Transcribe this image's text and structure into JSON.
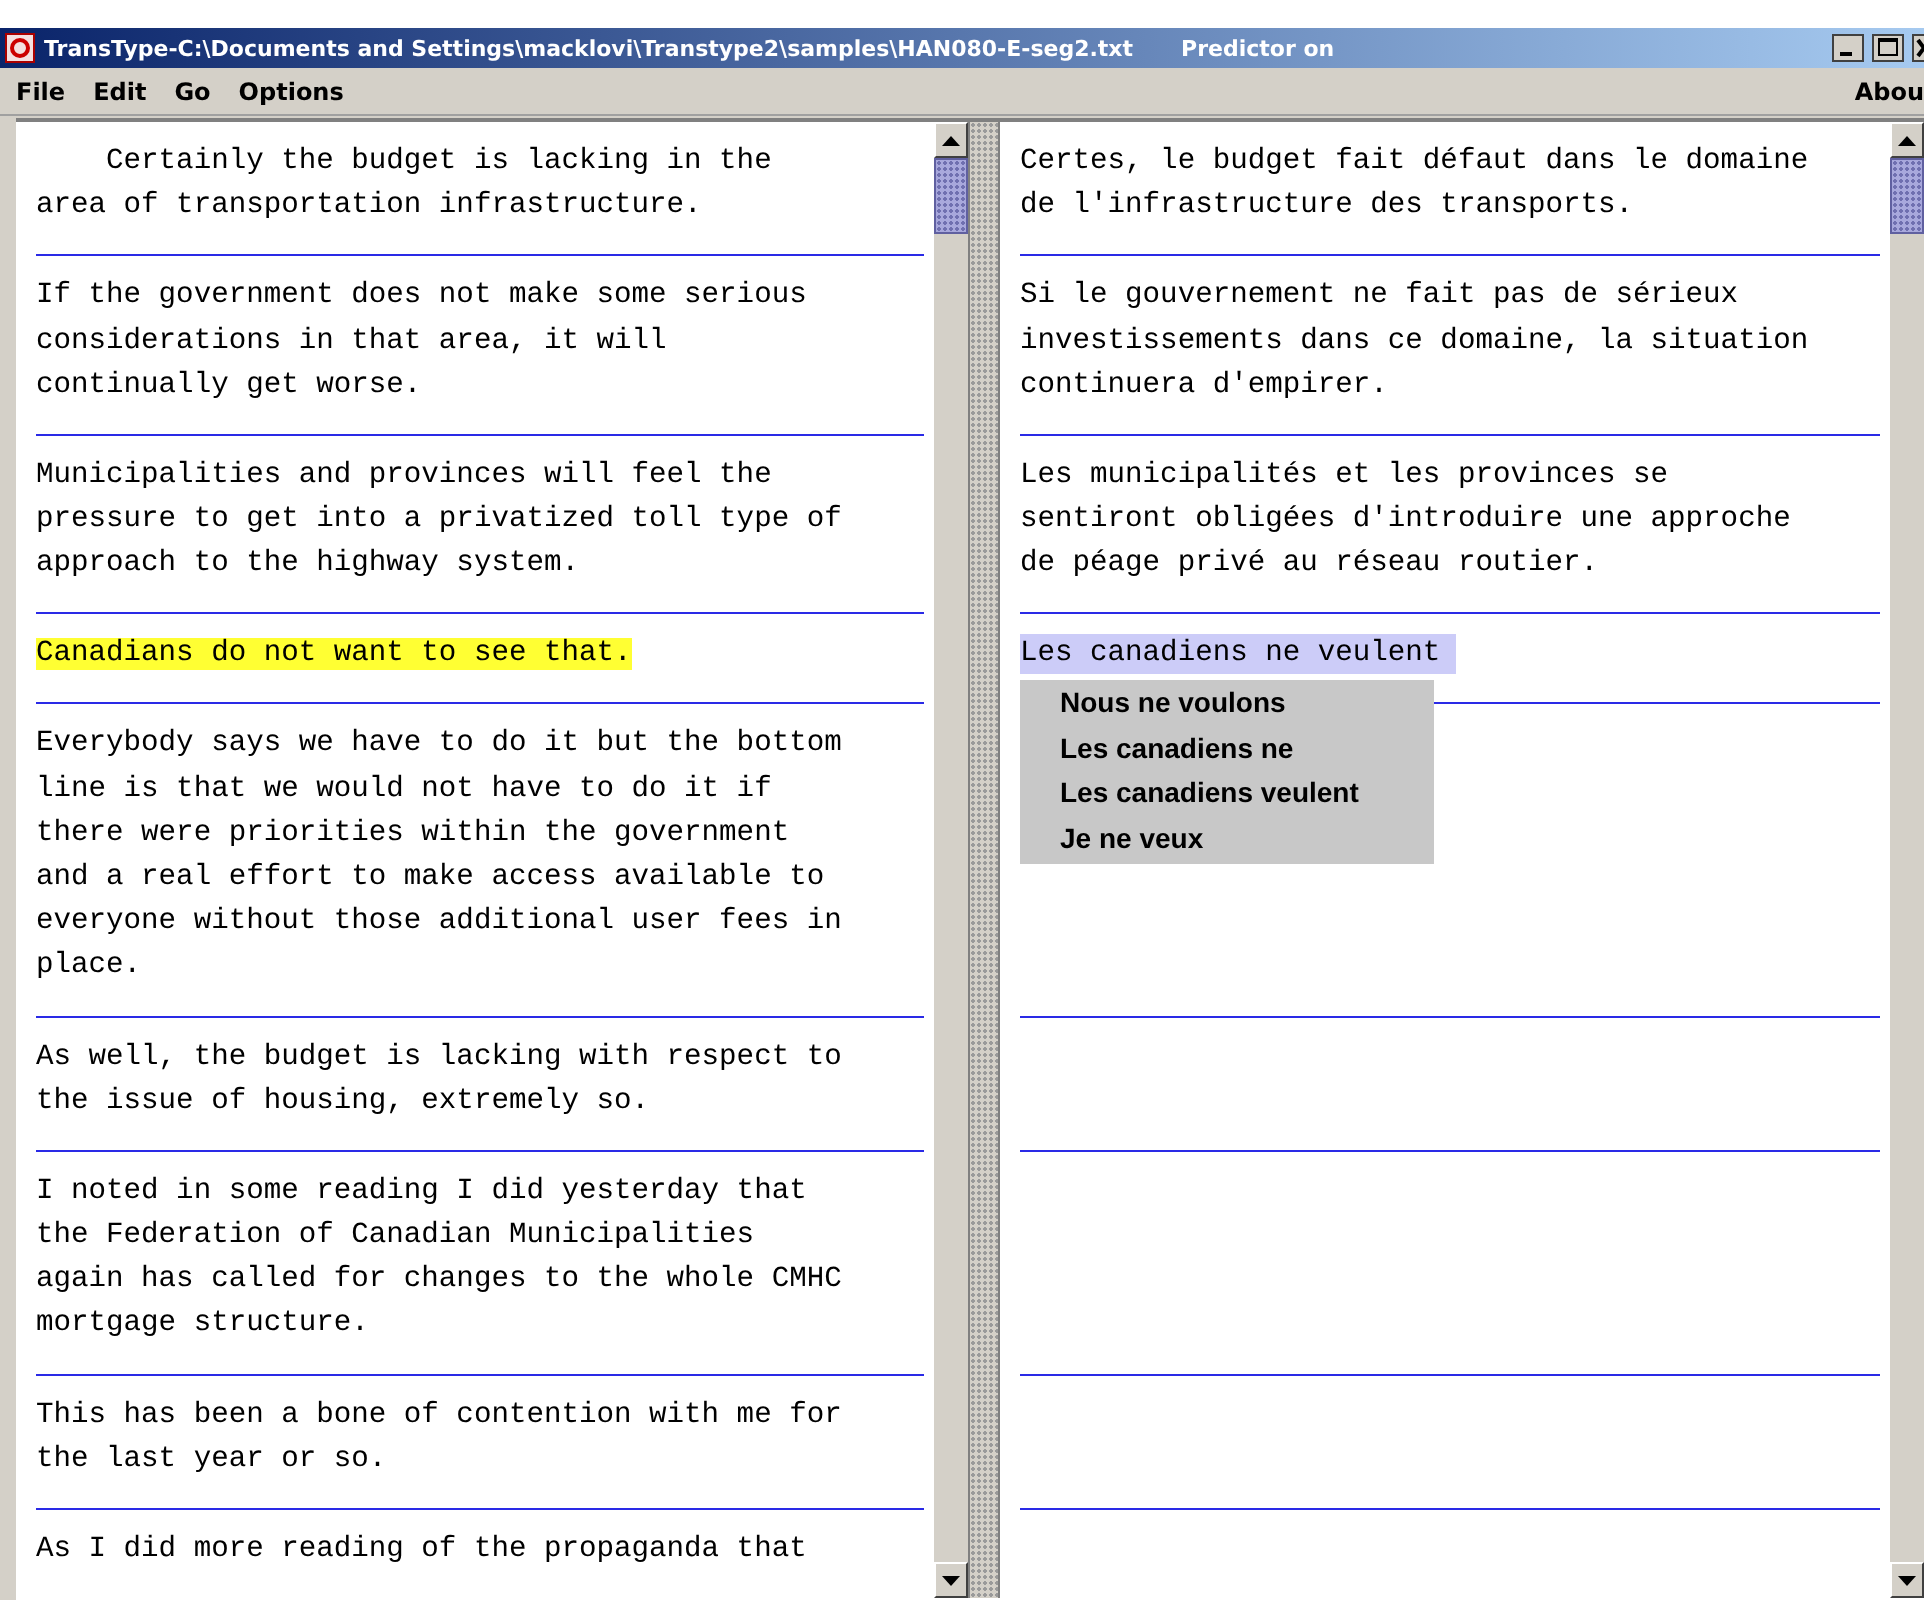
{
  "window": {
    "title": "TransType-C:\\Documents and Settings\\macklovi\\Transtype2\\samples\\HAN080-E-seg2.txt",
    "status": "Predictor on"
  },
  "menu": [
    "File",
    "Edit",
    "Go",
    "Options"
  ],
  "menu_right": "Abou",
  "segments": [
    {
      "source": "    Certainly the budget is lacking in the area of transportation infrastructure.",
      "target": "Certes, le budget fait défaut dans le domaine de l'infrastructure des transports.",
      "current": false
    },
    {
      "source": "If the government does not make some serious considerations in that area, it will continually get worse.",
      "target": "Si le gouvernement ne fait pas de sérieux investissements dans ce domaine, la situation continuera d'empirer.",
      "current": false
    },
    {
      "source": "Municipalities and provinces will feel the pressure to get into a privatized toll type of approach to the highway system.",
      "target": "Les municipalités et les provinces se sentiront obligées d'introduire une approche de péage privé au réseau routier.",
      "current": false
    },
    {
      "source": "Canadians do not want to see that.",
      "target": "Les canadiens ne veulent",
      "current": true
    },
    {
      "source": "Everybody says we have to do it but the bottom line is that we would not have to do it if there were priorities within the government and a real effort to make access available to everyone without those additional user fees in place.",
      "current": false
    },
    {
      "source": "As well, the budget is lacking with respect to the issue of housing, extremely so.",
      "current": false
    },
    {
      "source": "I noted in some reading I did yesterday that the Federation of Canadian Municipalities again has called for changes to the whole CMHC mortgage structure.",
      "current": false
    },
    {
      "source": "This has been a bone of contention with me for the last year or so.",
      "current": false
    },
    {
      "source": "As I did more reading of the propaganda that",
      "current": false
    }
  ],
  "suggestions": [
    "Nous ne voulons",
    "Les canadiens ne",
    "Les canadiens veulent",
    "Je ne veux"
  ]
}
